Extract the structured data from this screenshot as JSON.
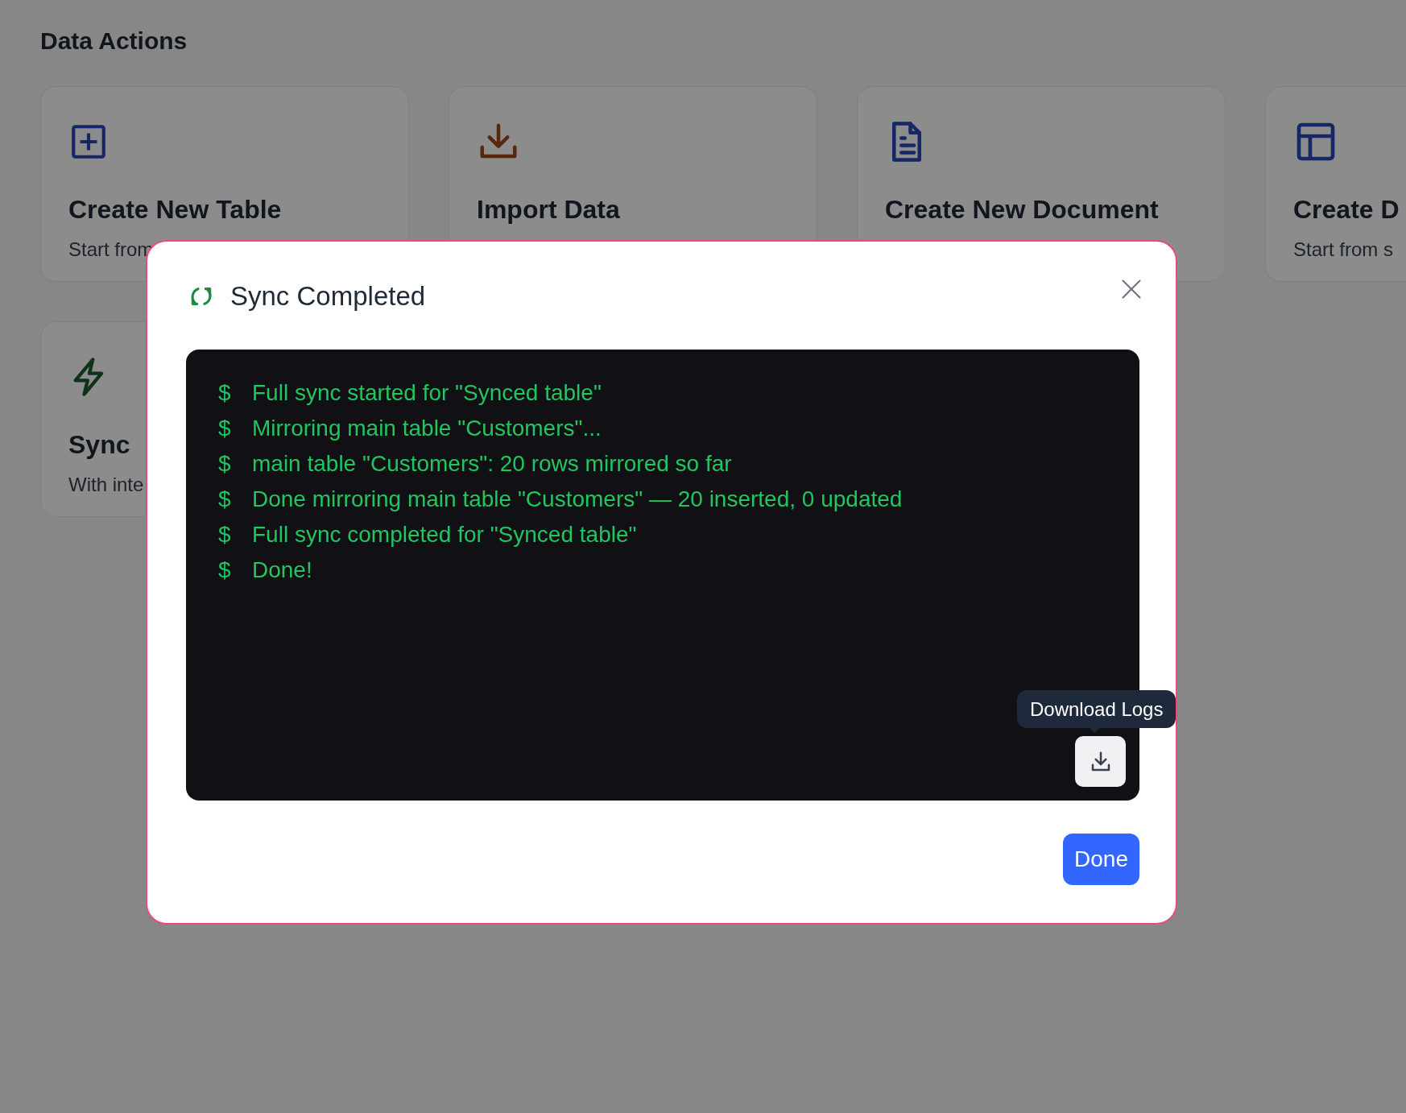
{
  "page_title": "Data Actions",
  "cards": [
    {
      "title": "Create New Table",
      "description": "Start from"
    },
    {
      "title": "Import Data"
    },
    {
      "title": "Create New Document"
    },
    {
      "title": "Create D",
      "description": "Start from s"
    },
    {
      "title": "Sync",
      "description": "With inte"
    }
  ],
  "dialog": {
    "title": "Sync Completed",
    "log_lines": [
      {
        "prompt": "$",
        "text": "Full sync started for \"Synced table\""
      },
      {
        "prompt": "$",
        "text": "Mirroring main table \"Customers\"..."
      },
      {
        "prompt": "$",
        "text": "main table \"Customers\": 20 rows mirrored so far"
      },
      {
        "prompt": "$",
        "text": "Done mirroring main table \"Customers\" — 20 inserted, 0 updated"
      },
      {
        "prompt": "$",
        "text": "Full sync completed for \"Synced table\""
      },
      {
        "prompt": "$",
        "text": "Done!"
      }
    ],
    "tooltip": "Download Logs",
    "done_button": "Done"
  }
}
